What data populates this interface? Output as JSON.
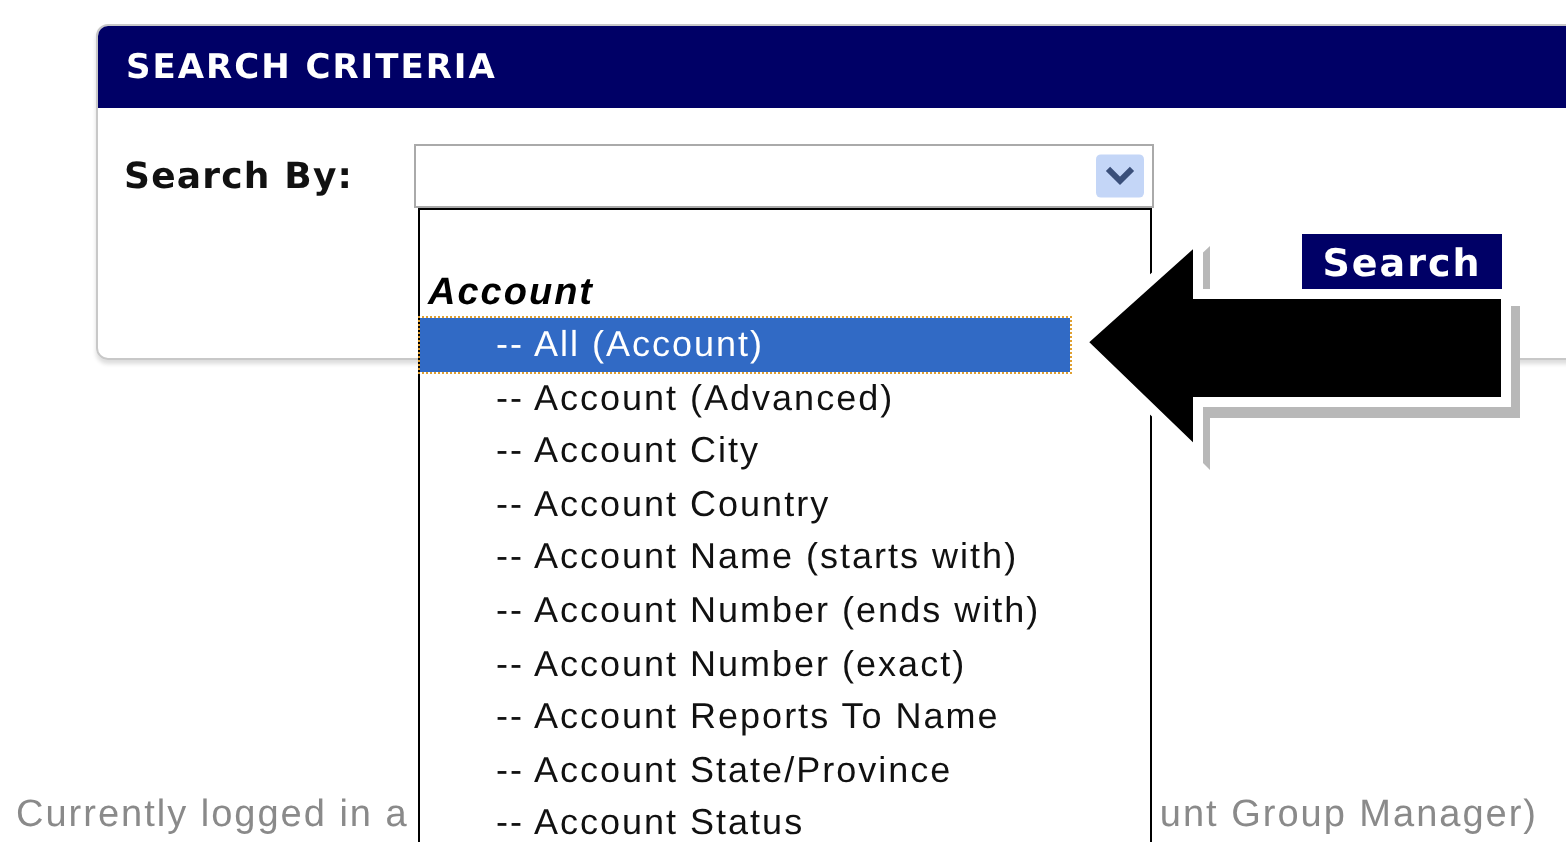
{
  "panel": {
    "title": "SEARCH CRITERIA",
    "search_by_label": "Search By:",
    "search_button": "Search"
  },
  "dropdown": {
    "group": "Account",
    "options": [
      {
        "label": "-- All (Account)",
        "selected": true
      },
      {
        "label": "-- Account (Advanced)",
        "selected": false
      },
      {
        "label": "-- Account City",
        "selected": false
      },
      {
        "label": "-- Account Country",
        "selected": false
      },
      {
        "label": "-- Account Name (starts with)",
        "selected": false
      },
      {
        "label": "-- Account Number (ends with)",
        "selected": false
      },
      {
        "label": "-- Account Number (exact)",
        "selected": false
      },
      {
        "label": "-- Account Reports To Name",
        "selected": false
      },
      {
        "label": "-- Account State/Province",
        "selected": false
      },
      {
        "label": "-- Account Status",
        "selected": false
      }
    ]
  },
  "footer": {
    "left": "Currently logged in a",
    "right": "unt Group Manager)"
  }
}
